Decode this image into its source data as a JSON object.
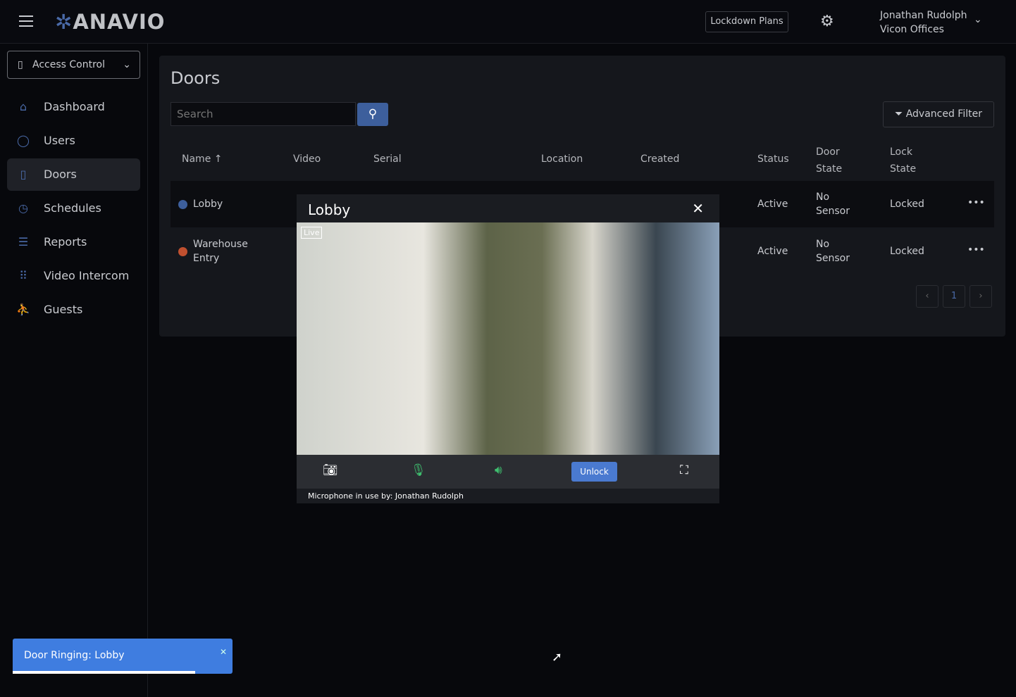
{
  "header": {
    "logo": "ANAVIO",
    "lockdown": "Lockdown Plans",
    "user_name": "Jonathan Rudolph",
    "user_org": "Vicon Offices"
  },
  "sidebar": {
    "module": "Access Control",
    "items": [
      {
        "label": "Dashboard",
        "icon": "home-icon"
      },
      {
        "label": "Users",
        "icon": "user-icon"
      },
      {
        "label": "Doors",
        "icon": "door-icon",
        "active": true
      },
      {
        "label": "Schedules",
        "icon": "clock-icon"
      },
      {
        "label": "Reports",
        "icon": "report-icon"
      },
      {
        "label": "Video Intercom",
        "icon": "grid-icon"
      },
      {
        "label": "Guests",
        "icon": "guest-icon"
      }
    ]
  },
  "main": {
    "title": "Doors",
    "search_placeholder": "Search",
    "advanced_filter": "Advanced Filter",
    "columns": [
      "Name ↑",
      "Video",
      "Serial",
      "Location",
      "Created",
      "Status",
      "Door State",
      "Lock State"
    ],
    "rows": [
      {
        "name": "Lobby",
        "color": "#3d5f9c",
        "status": "Active",
        "door_state": "No Sensor",
        "lock_state": "Locked"
      },
      {
        "name": "Warehouse Entry",
        "color": "#c0502f",
        "status": "Active",
        "door_state": "No Sensor",
        "lock_state": "Locked"
      }
    ],
    "page": "1"
  },
  "modal": {
    "title": "Lobby",
    "live": "Live",
    "unlock": "Unlock",
    "mic_status": "Microphone in use by: Jonathan Rudolph"
  },
  "toast": {
    "message": "Door Ringing: Lobby",
    "progress": 0.83
  }
}
